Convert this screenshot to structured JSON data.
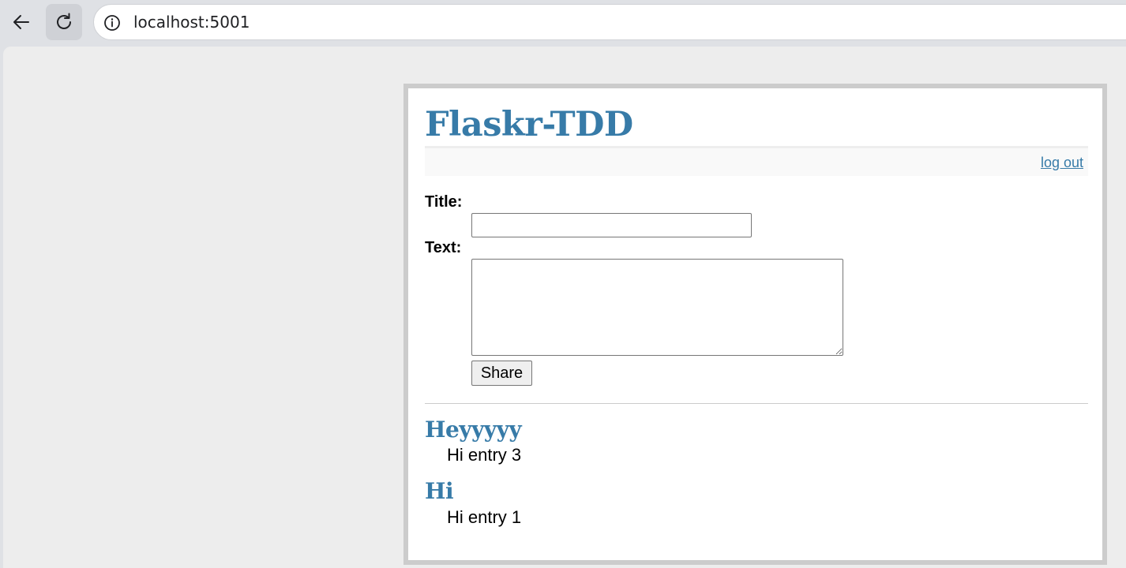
{
  "browser": {
    "url": "localhost:5001"
  },
  "app": {
    "title": "Flaskr-TDD",
    "logout_label": "log out"
  },
  "form": {
    "title_label": "Title:",
    "title_value": "",
    "text_label": "Text:",
    "text_value": "",
    "share_label": "Share"
  },
  "entries": [
    {
      "title": "Heyyyyy",
      "text": "Hi entry 3"
    },
    {
      "title": "Hi",
      "text": "Hi entry 1"
    }
  ],
  "colors": {
    "accent": "#377ba8",
    "border": "#cccccc",
    "background": "#ededed"
  },
  "icons": [
    "back-arrow-icon",
    "reload-icon",
    "info-icon"
  ]
}
